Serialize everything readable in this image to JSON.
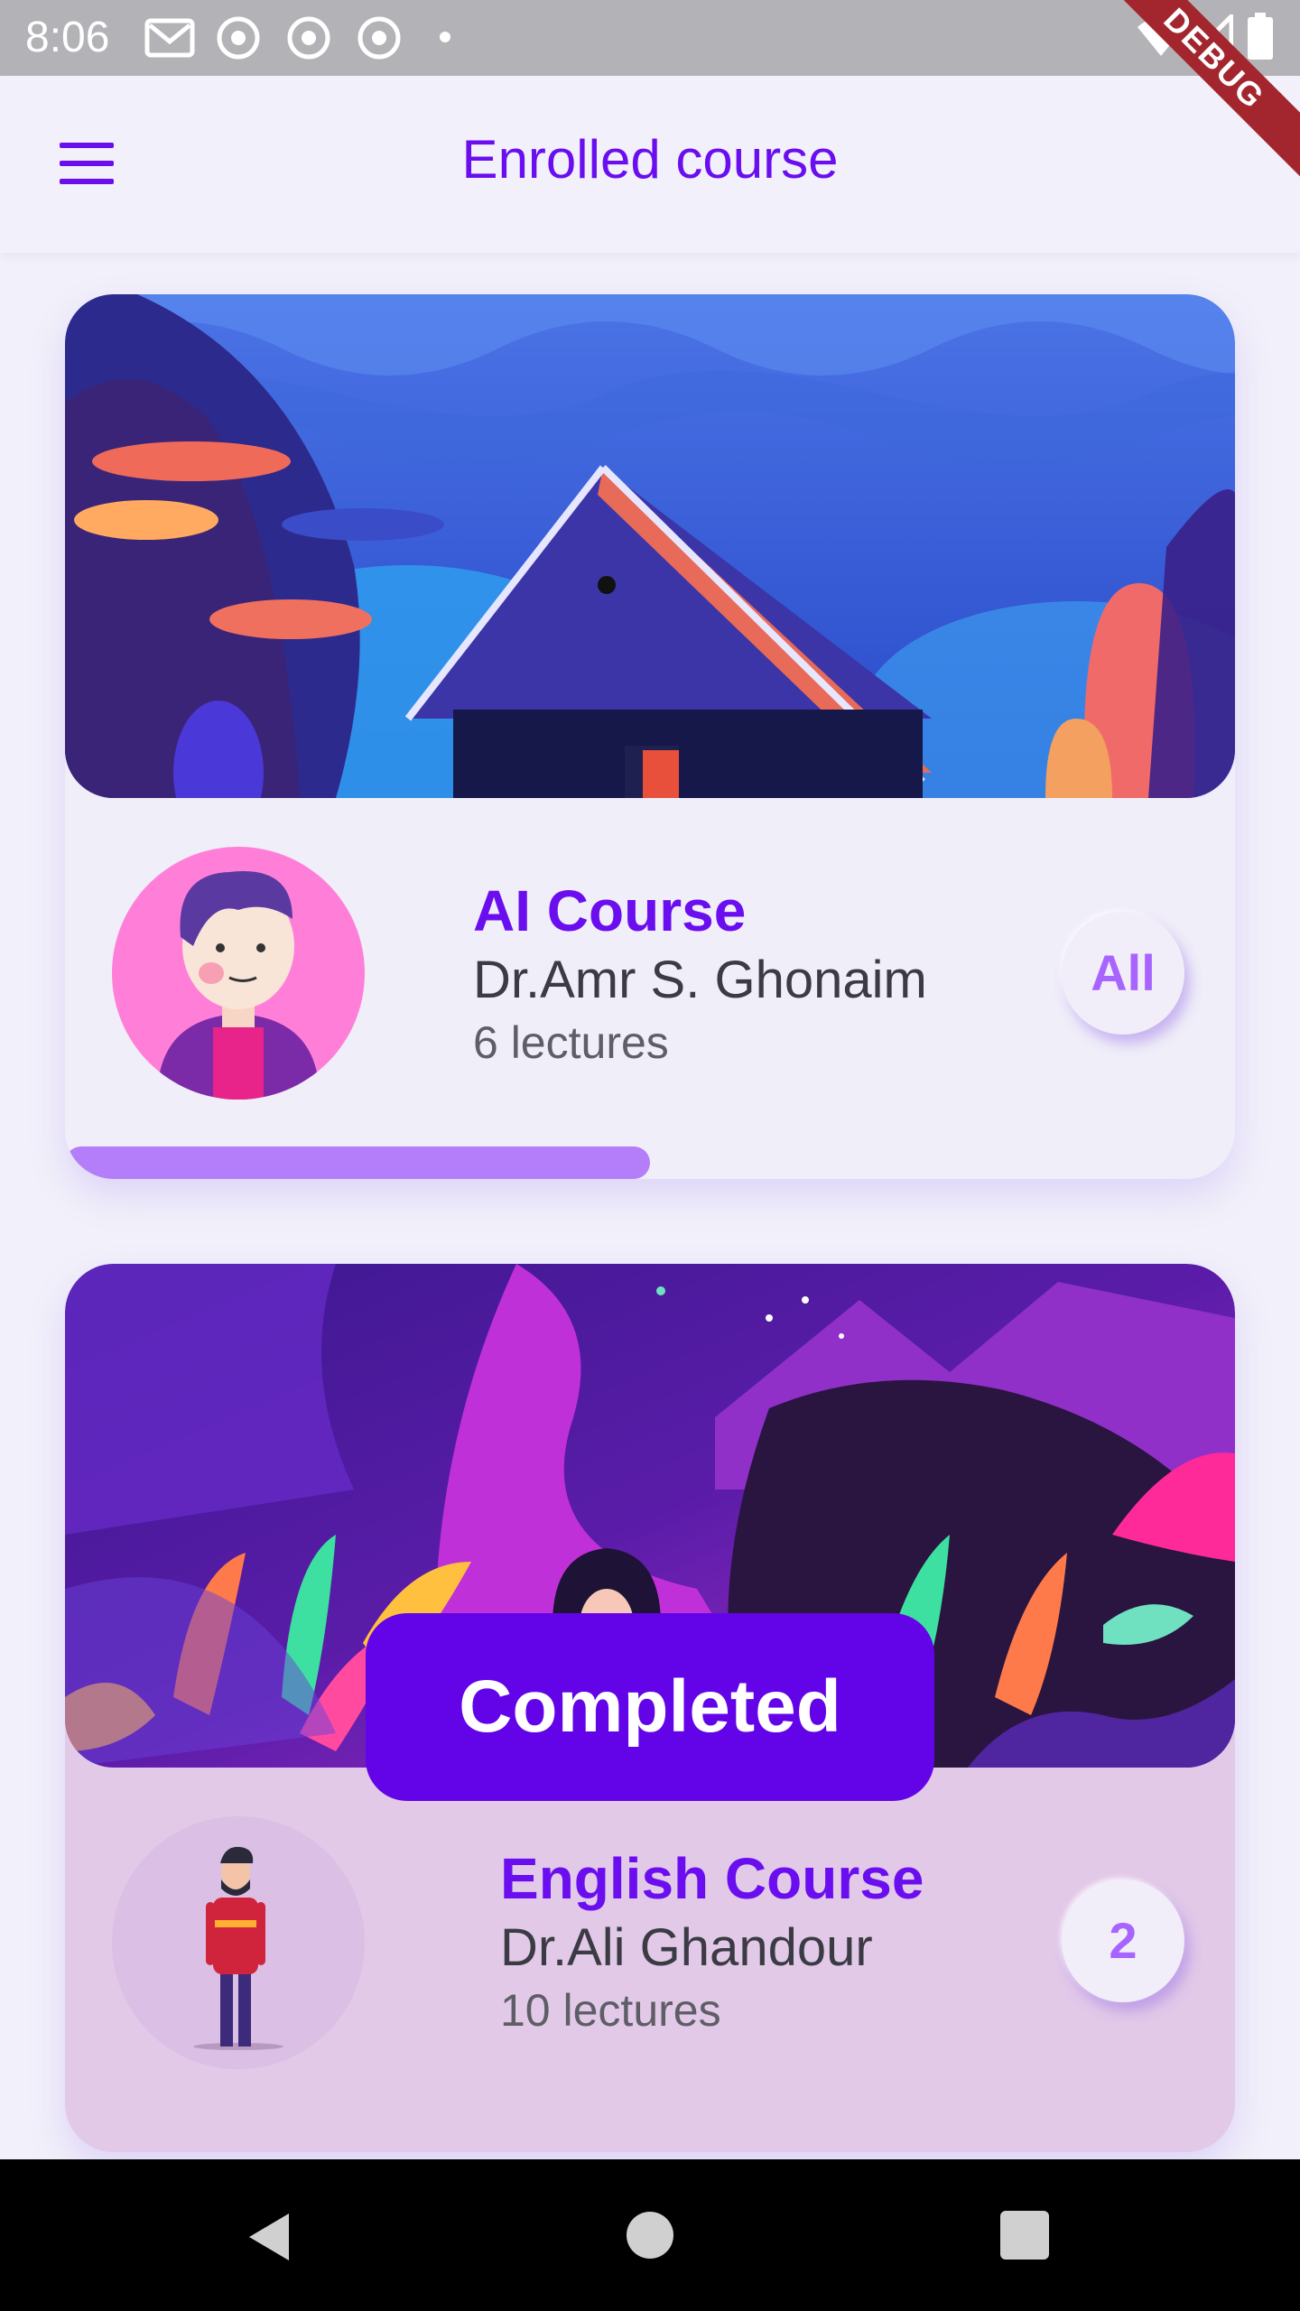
{
  "status_bar": {
    "time": "8:06",
    "icons": [
      "gmail-icon",
      "chrome-icon",
      "chrome-icon",
      "chrome-icon",
      "dot-icon",
      "wifi-icon",
      "signal-icon",
      "battery-icon"
    ],
    "debug_label": "DEBUG"
  },
  "app_bar": {
    "title": "Enrolled course",
    "menu_icon": "hamburger-menu-icon"
  },
  "courses": [
    {
      "title": "AI Course",
      "teacher": "Dr.Amr S. Ghonaim",
      "lectures": "6 lectures",
      "badge": "All",
      "progress_fraction": 0.5,
      "banner_icon": "house-landscape-illustration",
      "avatar_icon": "boy-avatar-illustration"
    },
    {
      "title": "English Course",
      "teacher": "Dr.Ali Ghandour",
      "lectures": "10 lectures",
      "badge": "2",
      "status": "Completed",
      "banner_icon": "jungle-girl-illustration",
      "avatar_icon": "man-standing-illustration"
    }
  ],
  "nav_bar": {
    "icons": [
      "back-icon",
      "home-icon",
      "recent-apps-icon"
    ]
  },
  "colors": {
    "accent": "#6a0ef0",
    "progress": "#b47efa",
    "completed_bg": "#6303e8",
    "badge_text": "#a864ff"
  }
}
